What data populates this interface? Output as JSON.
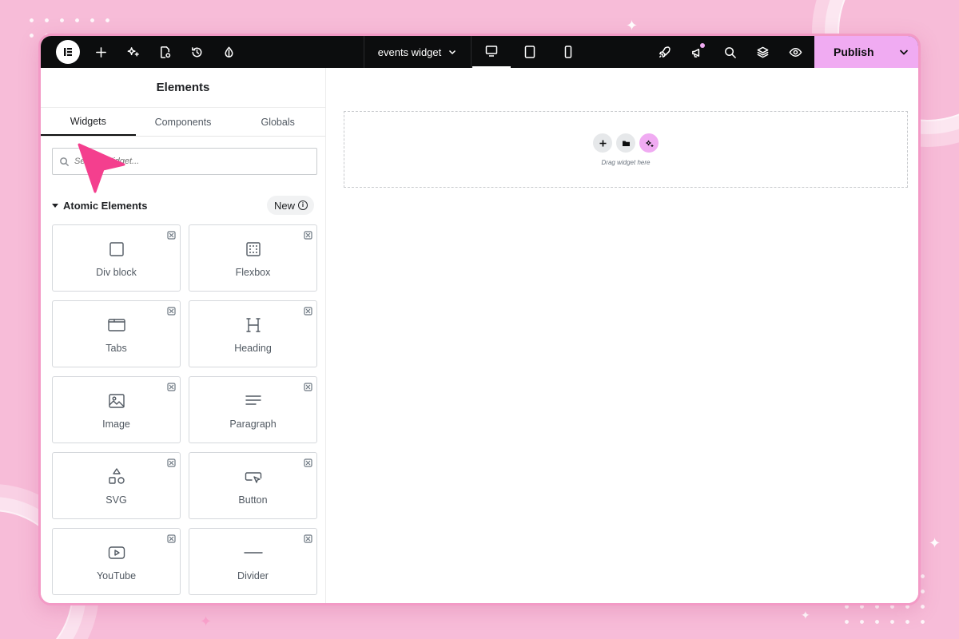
{
  "topbar": {
    "document_title": "events widget",
    "publish_label": "Publish"
  },
  "panel": {
    "title": "Elements",
    "tabs": [
      {
        "label": "Widgets",
        "active": true
      },
      {
        "label": "Components",
        "active": false
      },
      {
        "label": "Globals",
        "active": false
      }
    ],
    "search": {
      "placeholder": "Search Widget..."
    },
    "section": {
      "title": "Atomic Elements",
      "badge": "New"
    },
    "widgets": [
      {
        "label": "Div block",
        "icon": "div-block-icon"
      },
      {
        "label": "Flexbox",
        "icon": "flexbox-icon"
      },
      {
        "label": "Tabs",
        "icon": "tabs-icon"
      },
      {
        "label": "Heading",
        "icon": "heading-icon"
      },
      {
        "label": "Image",
        "icon": "image-icon"
      },
      {
        "label": "Paragraph",
        "icon": "paragraph-icon"
      },
      {
        "label": "SVG",
        "icon": "svg-shapes-icon"
      },
      {
        "label": "Button",
        "icon": "button-cursor-icon"
      },
      {
        "label": "YouTube",
        "icon": "youtube-icon"
      },
      {
        "label": "Divider",
        "icon": "divider-icon"
      }
    ]
  },
  "canvas": {
    "dropzone_text": "Drag widget here"
  },
  "colors": {
    "background": "#f7bcd8",
    "topbar": "#0c0d0e",
    "publish_accent": "#f0abf2",
    "cursor": "#f43f8e"
  }
}
